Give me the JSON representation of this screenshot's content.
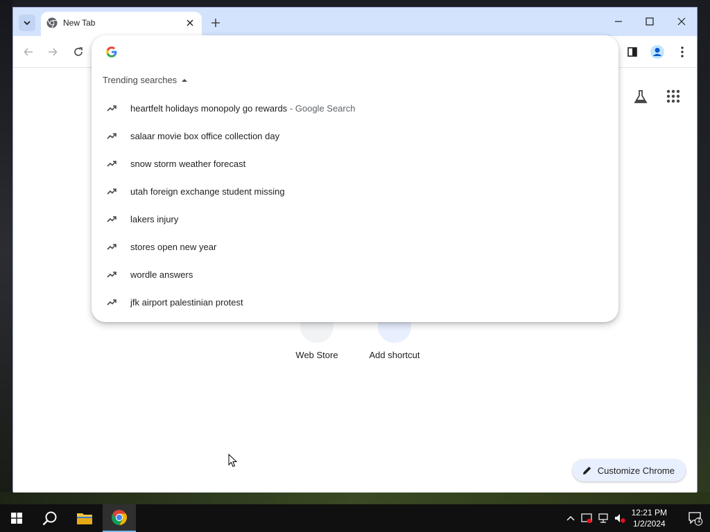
{
  "browser": {
    "tab_title": "New Tab",
    "window_controls": {
      "minimize": "minimize-icon",
      "maximize": "maximize-icon",
      "close": "close-icon"
    }
  },
  "omnibox": {
    "value": "",
    "trending_header": "Trending searches",
    "suggestions": [
      {
        "text": "heartfelt holidays monopoly go rewards",
        "suffix": "- Google Search"
      },
      {
        "text": "salaar movie box office collection day",
        "suffix": ""
      },
      {
        "text": "snow storm weather forecast",
        "suffix": ""
      },
      {
        "text": "utah foreign exchange student missing",
        "suffix": ""
      },
      {
        "text": "lakers injury",
        "suffix": ""
      },
      {
        "text": "stores open new year",
        "suffix": ""
      },
      {
        "text": "wordle answers",
        "suffix": ""
      },
      {
        "text": "jfk airport palestinian protest",
        "suffix": ""
      }
    ]
  },
  "shortcuts": [
    {
      "label": "Web Store"
    },
    {
      "label": "Add shortcut"
    }
  ],
  "customize": {
    "label": "Customize Chrome"
  },
  "taskbar": {
    "time": "12:21 PM",
    "date": "1/2/2024",
    "notification_count": "1"
  },
  "colors": {
    "tabstrip": "#d3e3fd",
    "accent": "#0b57d0",
    "customize_bg": "#e8effe"
  }
}
